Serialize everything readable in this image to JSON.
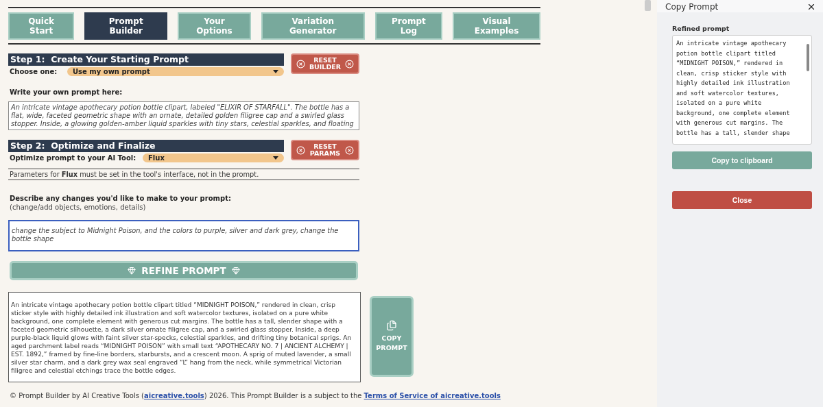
{
  "tabs": [
    {
      "label": "Quick Start",
      "selected": false
    },
    {
      "label": "Prompt Builder",
      "selected": true
    },
    {
      "label": "Your Options",
      "selected": false
    },
    {
      "label": "Variation Generator",
      "selected": false
    },
    {
      "label": "Prompt Log",
      "selected": false
    },
    {
      "label": "Visual Examples",
      "selected": false
    }
  ],
  "step1": {
    "title": "Step 1:  Create Your Starting Prompt",
    "reset_button": [
      "RESET",
      "BUILDER"
    ],
    "choose_label": "Choose one:",
    "choose_value": "Use my own prompt",
    "prompt_label": "Write your own prompt here:",
    "prompt_value": "An intricate vintage apothecary potion bottle clipart, labeled \"ELIXIR OF STARFALL\". The bottle has a flat, wide, faceted geometric shape with an ornate, detailed golden filigree cap and a swirled glass stopper. Inside, a glowing golden-amber liquid sparkles with tiny stars, celestial sparkles, and floating"
  },
  "step2": {
    "title": "Step 2:  Optimize and Finalize",
    "reset_button": [
      "RESET",
      "PARAMS"
    ],
    "tool_label": "Optimize prompt to your AI Tool:",
    "tool_value": "Flux",
    "note": "Parameters for **Flux** must be set in the tool's interface, not in the prompt.",
    "changes_label": "Describe any changes you'd like to make to your prompt:",
    "changes_hint": "(change/add objects, emotions, details)",
    "changes_value": "change the subject to Midnight Poison, and the colors to purple, silver and dark grey, change the bottle shape",
    "refine_button": "REFINE PROMPT",
    "result": "An intricate vintage apothecary potion bottle clipart titled “MIDNIGHT POISON,” rendered in clean, crisp sticker style with highly detailed ink illustration and soft watercolor textures, isolated on a pure white background, one complete element with generous cut margins. The bottle has a tall, slender shape with a faceted geometric silhouette, a dark silver ornate filigree cap, and a swirled glass stopper. Inside, a deep purple-black liquid glows with faint silver star-specks, celestial sparkles, and drifting tiny botanical sprigs. An aged parchment label reads “MIDNIGHT POISON” with small text “APOTHECARY NO. 7 | ANCIENT ALCHEMY | EST. 1892,” framed by fine-line borders, starbursts, and a crescent moon. A sprig of muted lavender, a small silver star charm, and a dark grey wax seal engraved “L” hang from the neck, while symmetrical Victorian filigree and celestial etchings trace the bottle edges.",
    "copy_button": [
      "COPY",
      "PROMPT"
    ]
  },
  "footer": [
    {
      "kind": "text",
      "text": "© Prompt Builder by AI Creative Tools ("
    },
    {
      "kind": "link",
      "text": "aicreative.tools"
    },
    {
      "kind": "text",
      "text": ") 2026. This Prompt Builder is a subject to the "
    },
    {
      "kind": "link",
      "text": "Terms of Service of aicreative.tools"
    }
  ],
  "panel": {
    "title": "Copy Prompt",
    "field_label": "Refined prompt",
    "field_value": "An intricate vintage apothecary potion bottle clipart titled “MIDNIGHT POISON,” rendered in clean, crisp sticker style with highly detailed ink illustration and soft watercolor textures, isolated on a pure white background, one complete element with generous cut margins. The bottle has a tall, slender shape",
    "copy_button": "Copy to clipboard",
    "close_button": "Close"
  }
}
